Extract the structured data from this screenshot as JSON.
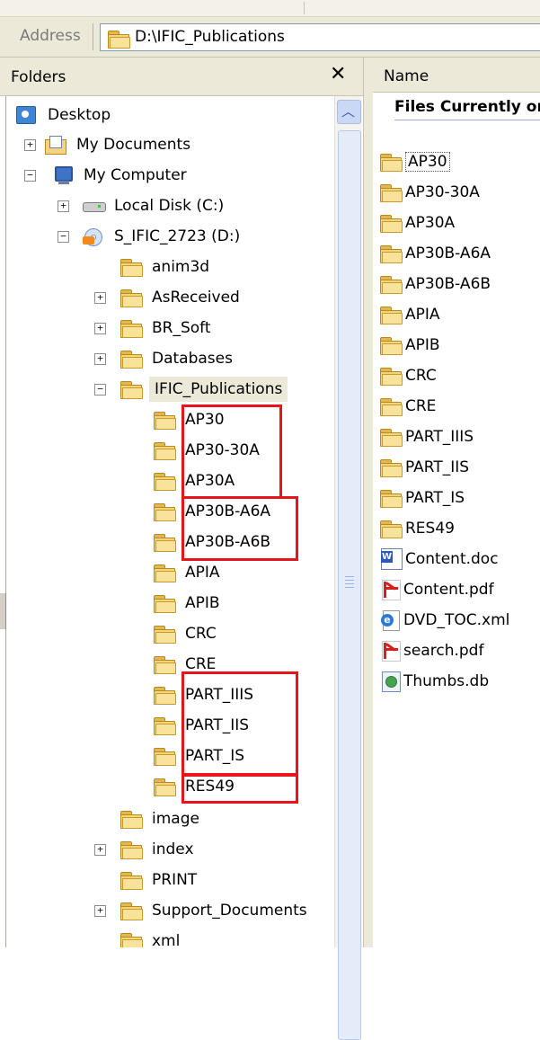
{
  "address": {
    "label": "Address",
    "path": "D:\\IFIC_Publications"
  },
  "folders_pane": {
    "title": "Folders",
    "close_glyph": "✕"
  },
  "tree": {
    "desktop": "Desktop",
    "my_documents": "My Documents",
    "my_computer": "My Computer",
    "local_disk": "Local Disk (C:)",
    "dvd_drive": "S_IFIC_2723 (D:)",
    "anim3d": "anim3d",
    "asreceived": "AsReceived",
    "br_soft": "BR_Soft",
    "databases": "Databases",
    "ific_publications": "IFIC_Publications",
    "sub": [
      "AP30",
      "AP30-30A",
      "AP30A",
      "AP30B-A6A",
      "AP30B-A6B",
      "APIA",
      "APIB",
      "CRC",
      "CRE",
      "PART_IIIS",
      "PART_IIS",
      "PART_IS",
      "RES49"
    ],
    "image": "image",
    "index": "index",
    "print": "PRINT",
    "support_documents": "Support_Documents",
    "xml": "xml"
  },
  "files_pane": {
    "column_name": "Name",
    "group_header": "Files Currently on the CD",
    "folders": [
      "AP30",
      "AP30-30A",
      "AP30A",
      "AP30B-A6A",
      "AP30B-A6B",
      "APIA",
      "APIB",
      "CRC",
      "CRE",
      "PART_IIIS",
      "PART_IIS",
      "PART_IS",
      "RES49"
    ],
    "files": [
      "Content.doc",
      "Content.pdf",
      "DVD_TOC.xml",
      "search.pdf",
      "Thumbs.db"
    ]
  },
  "colors": {
    "highlight_box": "#e8141b",
    "toolbar_bg": "#ece9d8",
    "folder_yellow": "#f4d47c"
  }
}
